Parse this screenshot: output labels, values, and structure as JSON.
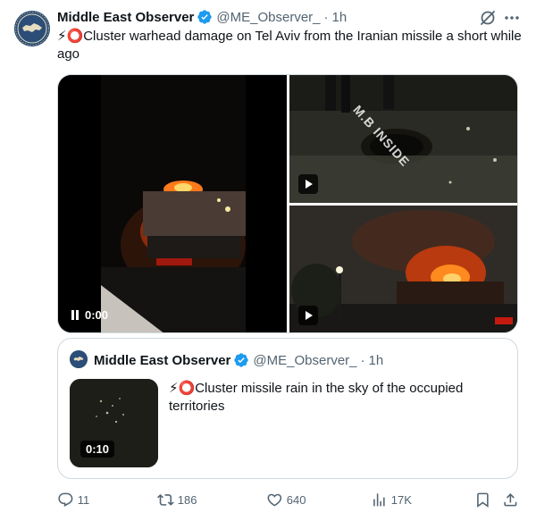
{
  "tweet": {
    "author": {
      "display_name": "Middle East Observer",
      "handle": "@ME_Observer_",
      "separator": "·",
      "time": "1h"
    },
    "text": "⚡⭕Cluster warhead damage on Tel Aviv from the Iranian missile a short while ago",
    "media": {
      "video_time": "0:00",
      "watermark": "M.B INSIDE"
    },
    "quoted": {
      "display_name": "Middle East Observer",
      "handle": "@ME_Observer_",
      "separator": "·",
      "time": "1h",
      "text": "⚡⭕Cluster missile rain in the sky of the occupied territories",
      "video_duration": "0:10"
    },
    "actions": {
      "replies": "11",
      "reposts": "186",
      "likes": "640",
      "views": "17K"
    }
  },
  "icons": {
    "verified": "verified-badge-icon",
    "grok": "grok-icon",
    "more": "more-icon",
    "reply": "reply-icon",
    "repost": "repost-icon",
    "like": "heart-icon",
    "views": "views-icon",
    "bookmark": "bookmark-icon",
    "share": "share-icon"
  },
  "colors": {
    "text": "#0f1419",
    "secondary": "#536471",
    "verified": "#1d9bf0",
    "border": "#cfd9de"
  }
}
